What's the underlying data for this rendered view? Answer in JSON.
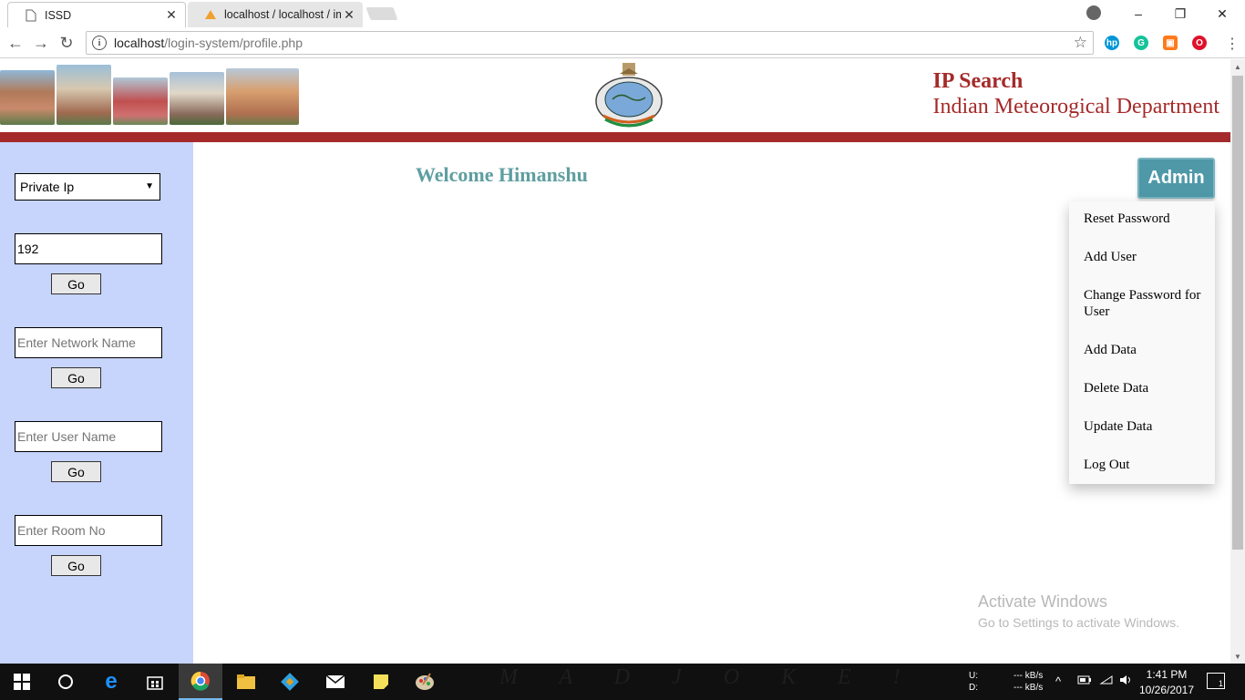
{
  "browser": {
    "tabs": [
      {
        "title": "ISSD",
        "active": true
      },
      {
        "title": "localhost / localhost / im",
        "active": false
      }
    ],
    "url_host": "localhost",
    "url_path": "/login-system/profile.php",
    "window_controls": {
      "minimize": "–",
      "restore": "❐",
      "close": "✕"
    }
  },
  "header": {
    "title": "IP Search",
    "subtitle": "Indian Meteorogical Department",
    "colors": {
      "brand": "#a52a2a",
      "bar": "#a52a2a"
    }
  },
  "sidebar": {
    "select_value": "Private Ip",
    "ip_value": "192",
    "network_placeholder": "Enter Network Name",
    "user_placeholder": "Enter User Name",
    "room_placeholder": "Enter Room No",
    "go_label": "Go",
    "color": "#c7d4fb"
  },
  "main": {
    "welcome": "Welcome Himanshu",
    "admin_label": "Admin",
    "menu": [
      "Reset Password",
      "Add User",
      "Change Password for User",
      "Add Data",
      "Delete Data",
      "Update Data",
      "Log Out"
    ]
  },
  "watermark": {
    "line1": "Activate Windows",
    "line2": "Go to Settings to activate Windows."
  },
  "taskbar": {
    "wallpaper_text": "M A D   J O K E !",
    "net_labels": "U:\nD:",
    "net_up": "--- kB/s",
    "net_down": "--- kB/s",
    "time": "1:41 PM",
    "date": "10/26/2017",
    "notifications": "1"
  }
}
